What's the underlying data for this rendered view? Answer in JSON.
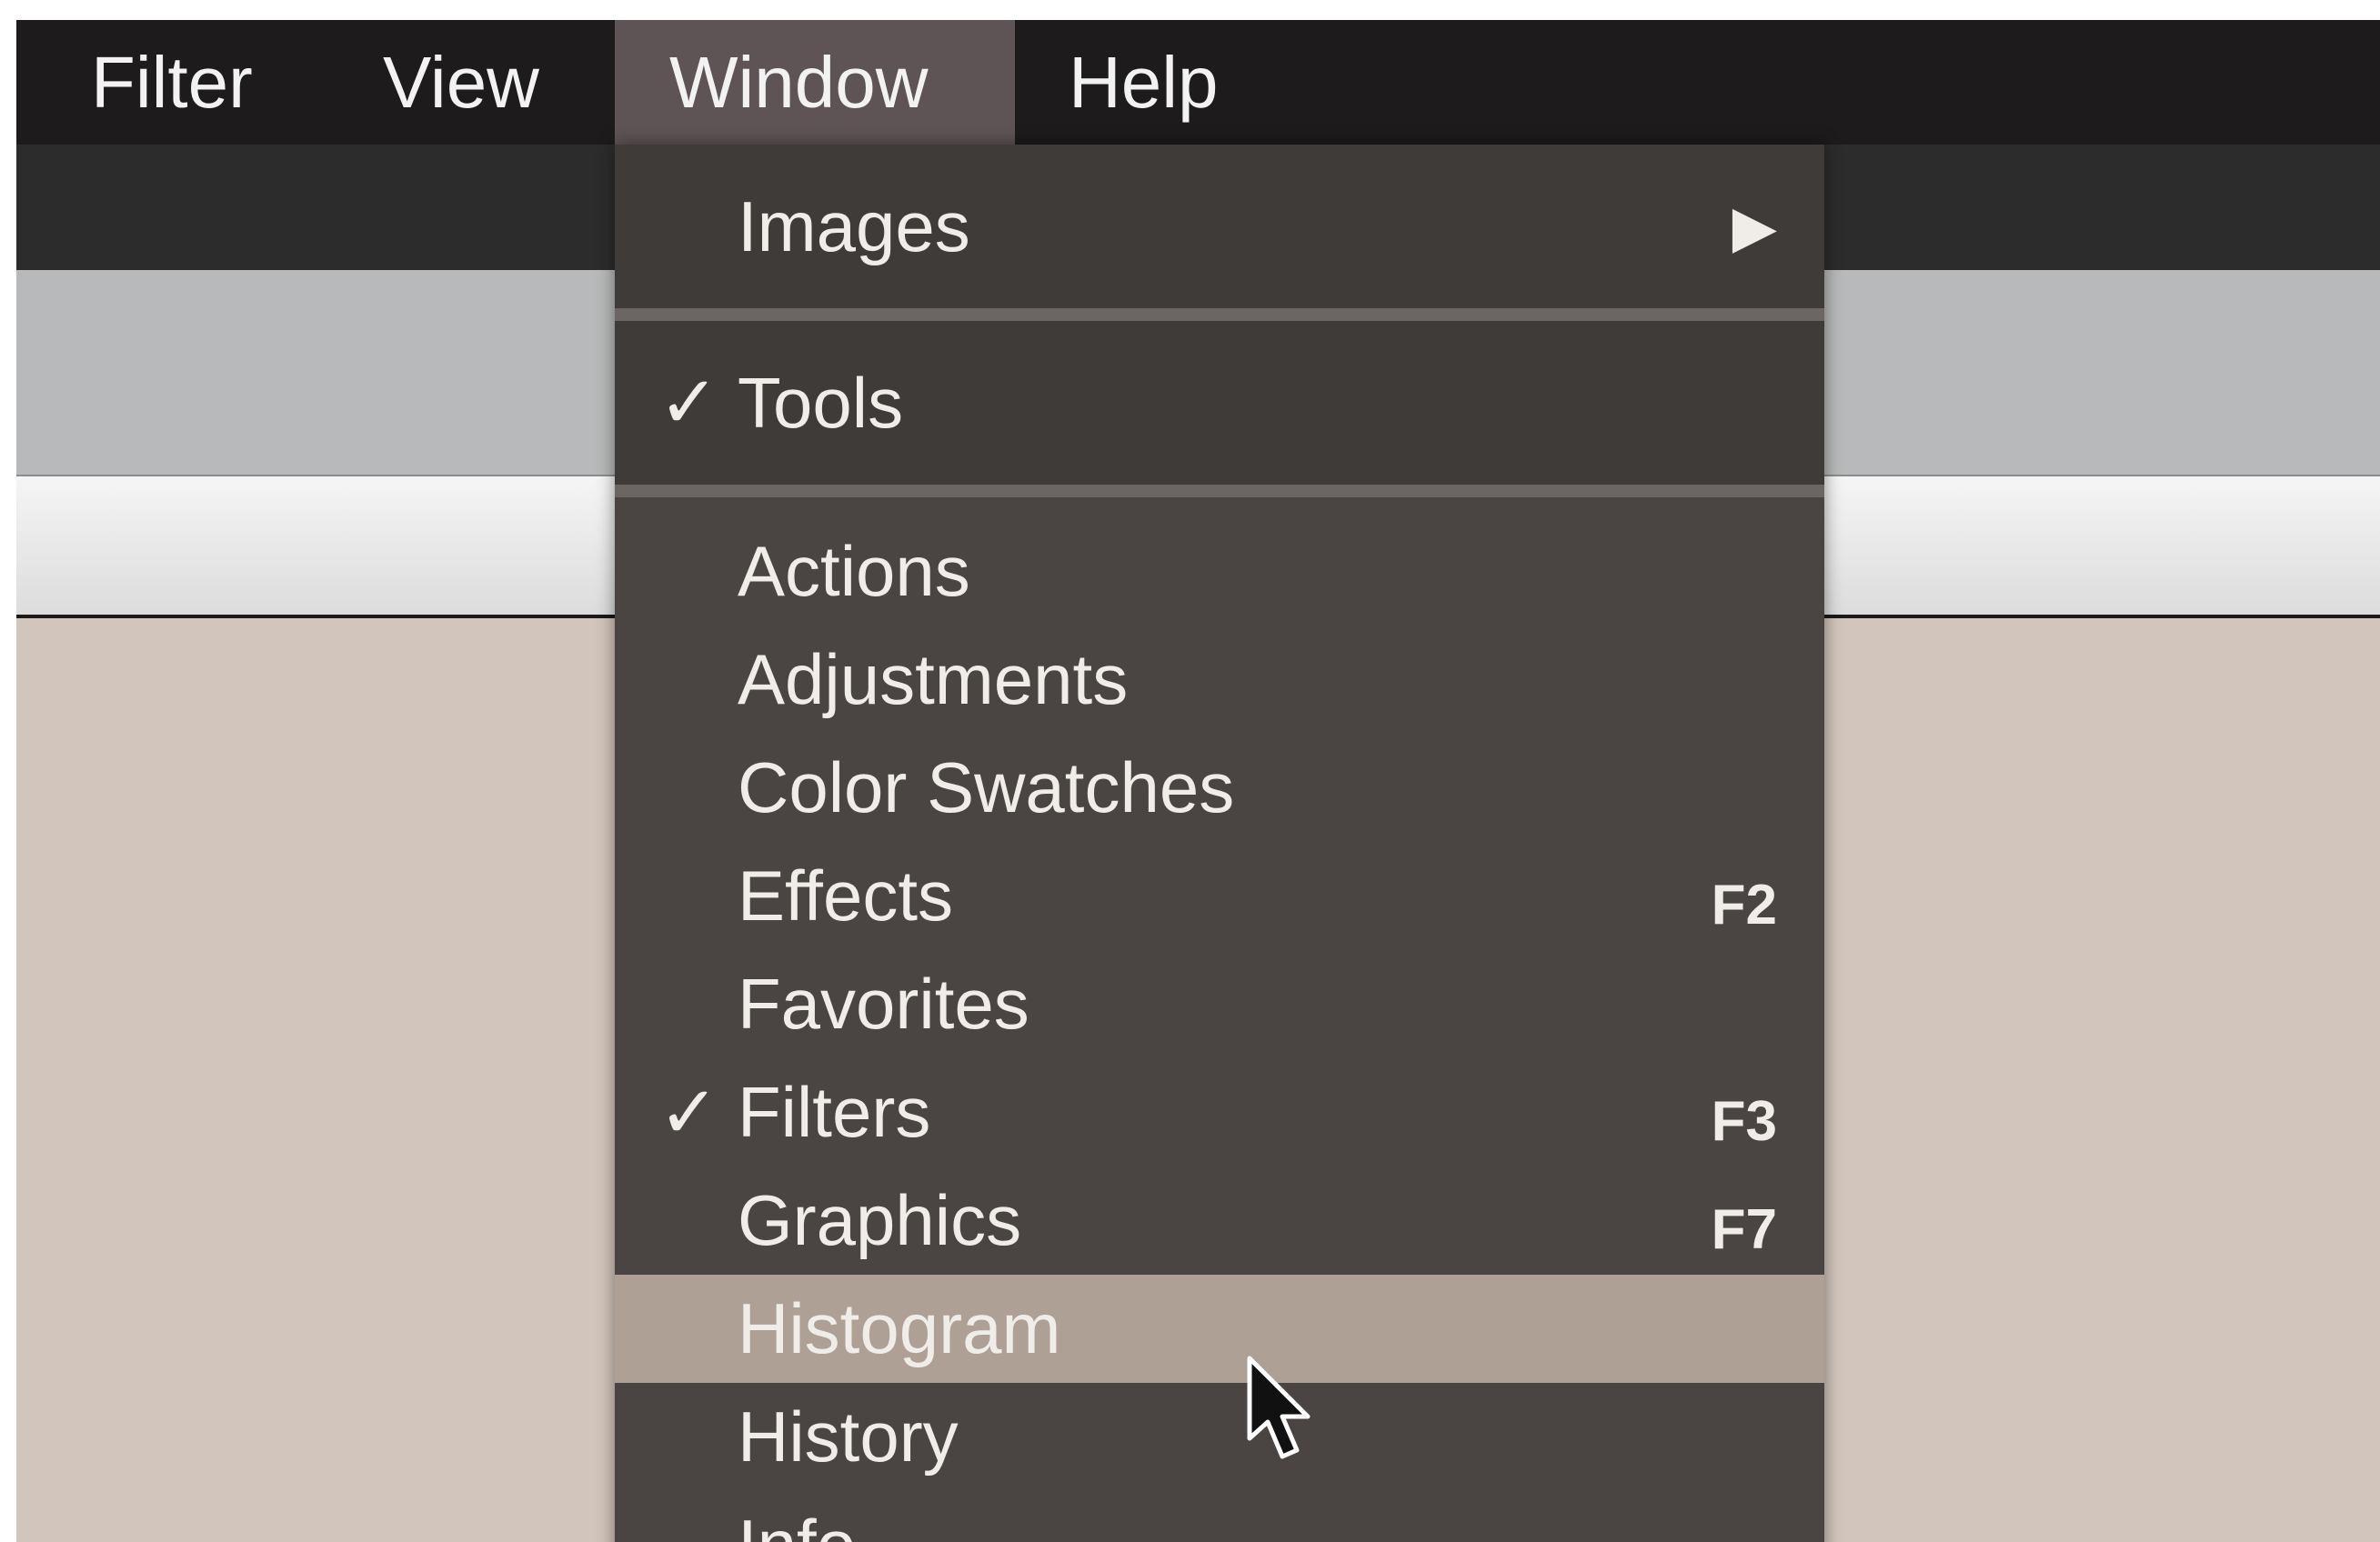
{
  "menubar": {
    "items": [
      {
        "label": "Filter"
      },
      {
        "label": "View"
      },
      {
        "label": "Window"
      },
      {
        "label": "Help"
      }
    ],
    "active": "Window"
  },
  "window_menu": {
    "groups": [
      {
        "items": [
          {
            "label": "Images",
            "submenu": true
          }
        ]
      },
      {
        "items": [
          {
            "label": "Tools",
            "checked": true
          }
        ]
      },
      {
        "items": [
          {
            "label": "Actions"
          },
          {
            "label": "Adjustments"
          },
          {
            "label": "Color Swatches"
          },
          {
            "label": "Effects",
            "shortcut": "F2"
          },
          {
            "label": "Favorites"
          },
          {
            "label": "Filters",
            "checked": true,
            "shortcut": "F3"
          },
          {
            "label": "Graphics",
            "shortcut": "F7"
          },
          {
            "label": "Histogram",
            "highlighted": true
          },
          {
            "label": "History"
          },
          {
            "label": "Info"
          }
        ]
      }
    ],
    "check_glyph": "✓",
    "submenu_glyph": "▶"
  },
  "colors": {
    "menubar_bg": "#1d1b1c",
    "menubar_active": "#5e5455",
    "menu_bg": "#4a4542",
    "menu_highlight": "#aea094",
    "workspace": "#d2c6bc"
  }
}
